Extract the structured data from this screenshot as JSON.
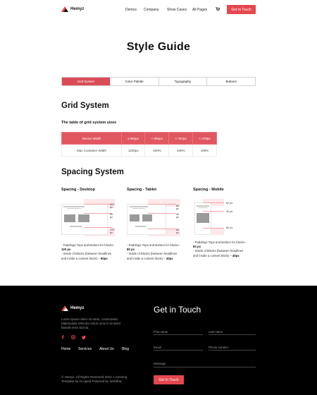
{
  "header": {
    "brand": "Hemyz",
    "nav": [
      "Demos",
      "Company",
      "Show Cases",
      "All Pages"
    ],
    "cta": "Get In Touch"
  },
  "title": "Style Guide",
  "tabs": [
    "Grid System",
    "Color Palette",
    "Typography",
    "Buttons"
  ],
  "grid": {
    "heading": "Grid System",
    "subheading": "The table of grid system sizes",
    "header_row": [
      "Device Width",
      "≥ 992px",
      "< 992px",
      "< 767px",
      "< 479px"
    ],
    "row": [
      "Max Container Width",
      "1200px",
      "100%",
      "100%",
      "100%"
    ]
  },
  "spacing": {
    "heading": "Spacing System",
    "desktop": {
      "title": "Spacing - Desktop",
      "labels": [
        "120 px",
        "60 px",
        "120 px"
      ],
      "desc1": "- Paddings Tops and Bottom for blocks -",
      "val1": "120 px",
      "desc2": "- Inside of Blocks (between headlines and inside a content block) –",
      "val2": "60px"
    },
    "tablet": {
      "title": "Spacing - Tablet",
      "labels": [
        "80 px",
        "40 px",
        "80 px"
      ],
      "desc1": "- Paddings Tops and Bottom for blocks -",
      "val1": "80 px",
      "desc2": "- Inside of Blocks (between headlines and inside a content block) –",
      "val2": "40px"
    },
    "mobile": {
      "title": "Spacing - Mobile",
      "labels": [
        "60 px",
        "40 px",
        "60 px"
      ],
      "desc1": "- Paddings Tops and Bottom for blocks -",
      "val1": "60 px",
      "desc2": "- Inside of Blocks (between headlines and inside a content block) –",
      "val2": "40px"
    }
  },
  "footer": {
    "brand": "Hemyz",
    "about": "Lorem ipsum dolor sit amet, consectetur. Malesuada vehicula netus urna in sit amet blandit enim lacinia.",
    "links": [
      "Home",
      "Services",
      "About Us",
      "Blog"
    ],
    "copyright": "© Hemyz. All Rights Reserved 2022. Licensing Template by eCopied Powered by Webflow",
    "contact_title": "Get in Touch",
    "fields": {
      "first_name": "First name",
      "last_name": "Last name",
      "email": "Email",
      "phone": "Phone number",
      "message": "Message"
    },
    "submit": "Get In Touch"
  },
  "colors": {
    "accent": "#e5484f",
    "band": "#fde8ea",
    "footer_bg": "#000000"
  },
  "icons": [
    "logo-mark-icon",
    "cart-icon",
    "facebook-icon",
    "instagram-icon",
    "twitter-icon"
  ]
}
